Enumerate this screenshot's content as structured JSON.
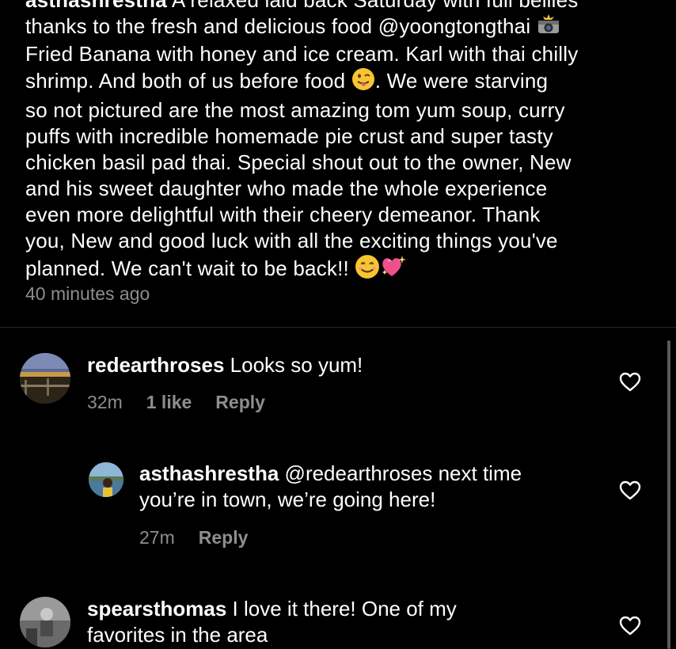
{
  "caption": {
    "username": "asthashrestha",
    "line1": "A relaxed laid back Saturday with full bellies",
    "line2": "thanks to the fresh and delicious food @yoongtongthai",
    "line3": "Fried Banana with honey and ice cream. Karl with thai chilly",
    "line4a": "shrimp. And both of us before food",
    "line4b": ". We were starving",
    "line5": "so not pictured are the most amazing tom yum soup, curry",
    "line6": "puffs with incredible homemade pie crust and super tasty",
    "line7": "chicken basil pad thai. Special shout out to the owner, New",
    "line8": "and his sweet daughter who made the whole experience",
    "line9": "even more delightful with their cheery demeanor. Thank",
    "line10": "you, New and good luck with all the exciting things you've",
    "line11": "planned. We can't wait to be back!!",
    "time": "40 minutes ago"
  },
  "comments": [
    {
      "username": "redearthroses",
      "text": "Looks so yum!",
      "time": "32m",
      "likes": "1 like",
      "reply": "Reply"
    },
    {
      "username": "asthashrestha",
      "text1": "@redearthroses next time",
      "text2": "you’re in town, we’re going here!",
      "time": "27m",
      "reply": "Reply"
    },
    {
      "username": "spearsthomas",
      "text1": "I love it there!  One of my",
      "text2": "favorites in the area"
    }
  ],
  "icons": {
    "camera": "camera-flash-icon",
    "tongue": "tongue-face-icon",
    "smile": "smiling-face-icon",
    "sparkle_heart": "sparkling-heart-icon",
    "like": "heart-outline-icon"
  },
  "colors": {
    "background": "#000000",
    "text": "#ffffff",
    "secondary": "#8e8e8e"
  }
}
